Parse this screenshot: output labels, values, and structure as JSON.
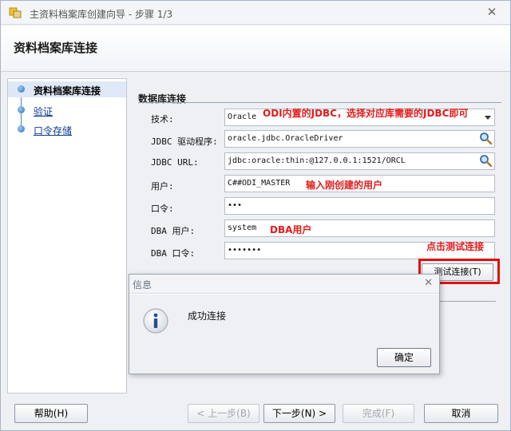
{
  "window": {
    "title": "主资料档案库创建向导 - 步骤 1/3",
    "header_title": "资料档案库连接"
  },
  "steps": [
    {
      "label": "资料档案库连接",
      "active": true
    },
    {
      "label": "验证",
      "active": false
    },
    {
      "label": "口令存储",
      "active": false
    }
  ],
  "section": {
    "title": "数据库连接"
  },
  "fields": {
    "technology": {
      "label": "技术:",
      "value": "Oracle"
    },
    "jdbc_driver": {
      "label": "JDBC 驱动程序:",
      "value": "oracle.jdbc.OracleDriver"
    },
    "jdbc_url": {
      "label": "JDBC URL:",
      "value": "jdbc:oracle:thin:@127.0.0.1:1521/ORCL"
    },
    "user": {
      "label": "用户:",
      "value": "C##ODI_MASTER"
    },
    "password": {
      "label": "口令:",
      "value": "•••"
    },
    "dba_user": {
      "label": "DBA 用户:",
      "value": "system"
    },
    "dba_password": {
      "label": "DBA 口令:",
      "value": "•••••••"
    }
  },
  "annotations": {
    "jdbc_note": "ODI内置的JDBC，选择对应库需要的JDBC即可",
    "user_note": "输入刚创建的用户",
    "dba_note": "DBA用户",
    "test_note": "点击测试连接"
  },
  "buttons": {
    "test_connection": "测试连接(T)",
    "help": "帮助(H)",
    "back": "< 上一步(B)",
    "next": "下一步(N) >",
    "finish": "完成(F)",
    "cancel": "取消"
  },
  "dialog": {
    "title": "信息",
    "message": "成功连接",
    "ok": "确定"
  },
  "colors": {
    "annotation": "#e31b1b",
    "accent": "#2a6fbf"
  }
}
